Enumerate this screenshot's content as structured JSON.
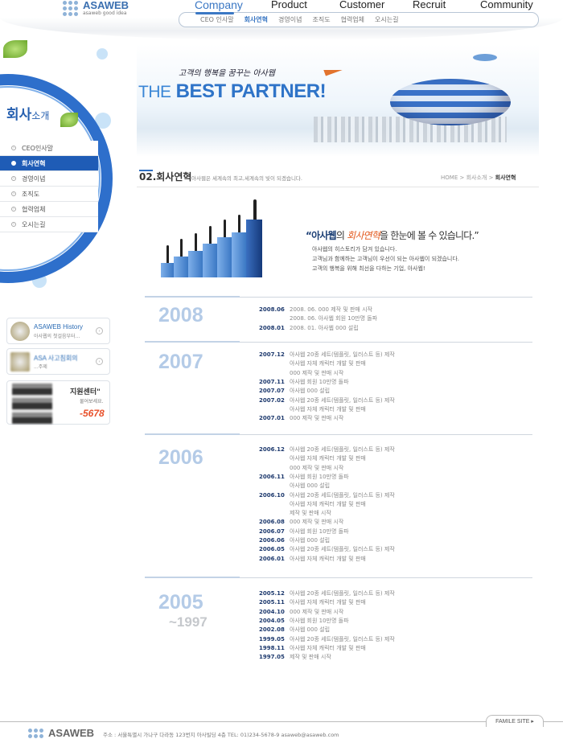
{
  "header": {
    "logo": "ASAWEB",
    "slogan": "asaweb good idea",
    "nav": [
      "Company",
      "Product",
      "Customer",
      "Recruit",
      "Community"
    ],
    "subnav": [
      "CEO 인사말",
      "회사연혁",
      "경영이념",
      "조직도",
      "협력업체",
      "오시는길"
    ],
    "active_subnav": 1
  },
  "sidebar": {
    "title": "회사",
    "title_small": "소개",
    "menu": [
      "CEO인사말",
      "회사연혁",
      "경영이념",
      "조직도",
      "협력업체",
      "오시는길"
    ],
    "active": 1,
    "boxes": [
      {
        "title": "ASAWEB History",
        "sub": "아사웹의 첫걸음부터..."
      },
      {
        "title": "ASA 사고침회의",
        "sub": "...주제"
      },
      {
        "title": "지원센터\"",
        "sub": "물어보세요.",
        "phone": "-5678"
      }
    ]
  },
  "banner": {
    "tagline": "고객의 행복을 꿈꾸는 아사웹",
    "the": "THE",
    "headline": "BEST PARTNER!"
  },
  "section": {
    "num": "02",
    "title": ".회사연혁",
    "subtitle": "아사웹은 세계속의 최고,세계속의 빛이 되겠습니다.",
    "breadcrumb": [
      "HOME",
      "회사소개",
      "회사연혁"
    ]
  },
  "intro": {
    "quote_pre": "“아사웹",
    "quote_mid": "의 ",
    "quote_hl": "회사연혁",
    "quote_post": "을 한눈에 볼 수 있습니다.”",
    "lines": [
      "아사웹의 히스토리가 담겨 있습니다.",
      "고객님과 함께하는 고객님이 우선이 되는 아사웹이 되겠습니다.",
      "고객의 행복을 위해 최선을 다하는 기업, 아사웹!"
    ]
  },
  "timeline": [
    {
      "year": "2008",
      "entries": [
        [
          "2008.06",
          "2008. 06. 000 제작 및 판매 시작"
        ],
        [
          "",
          "2008. 06. 아사웹 회원 10만명 돌파"
        ],
        [
          "2008.01",
          "2008. 01. 아사웹 000 설립"
        ]
      ]
    },
    {
      "year": "2007",
      "entries": [
        [
          "2007.12",
          "아사웹 20종 세트(템플릿, 일러스트 등) 제작"
        ],
        [
          "",
          "아사웹 자체 캐릭터 개발 및 판매"
        ],
        [
          "",
          "000 제작 및 판매 시작"
        ],
        [
          "2007.11",
          "아사웹 회원 10만명 돌파"
        ],
        [
          "2007.07",
          "아사웹 000 설립"
        ],
        [
          "2007.02",
          "아사웹 20종 세트(템플릿, 일러스트 등) 제작"
        ],
        [
          "",
          "아사웹 자체 캐릭터 개발 및 판매"
        ],
        [
          "2007.01",
          "000 제작 및 판매 시작"
        ]
      ]
    },
    {
      "year": "2006",
      "entries": [
        [
          "2006.12",
          "아사웹 20종 세트(템플릿, 일러스트 등) 제작"
        ],
        [
          "",
          "아사웹 자체 캐릭터 개발 및 판매"
        ],
        [
          "",
          "000 제작 및 판매 시작"
        ],
        [
          "2006.11",
          "아사웹 회원 10만명 돌파"
        ],
        [
          "",
          "아사웹 000 설립"
        ],
        [
          "2006.10",
          "아사웹 20종 세트(템플릿, 일러스트 등) 제작"
        ],
        [
          "",
          "아사웹 자체 캐릭터 개발 및 판매"
        ],
        [
          "",
          "제작 및 판매 시작"
        ],
        [
          "2006.08",
          "000 제작 및 판매 시작"
        ],
        [
          "2006.07",
          "아사웹 회원 10만명 돌파"
        ],
        [
          "2006.06",
          "아사웹 000 설립"
        ],
        [
          "2006.05",
          "아사웹 20종 세트(템플릿, 일러스트 등) 제작"
        ],
        [
          "2006.01",
          "아사웹 자체 캐릭터 개발 및 판매"
        ]
      ]
    },
    {
      "year": "2005",
      "year2": "~1997",
      "entries": [
        [
          "2005.12",
          "아사웹 20종 세트(템플릿, 일러스트 등) 제작"
        ],
        [
          "2005.11",
          "아사웹 자체 캐릭터 개발 및 판매"
        ],
        [
          "2004.10",
          "000 제작 및 판매 시작"
        ],
        [
          "2004.05",
          "아사웹 회원 10만명 돌파"
        ],
        [
          "2002.08",
          "아사웹 000 설립"
        ],
        [
          "1999.05",
          "아사웹 20종 세트(템플릿, 일러스트 등) 제작"
        ],
        [
          "1998.11",
          "아사웹 자체 캐릭터 개발 및 판매"
        ],
        [
          "1997.05",
          "제작 및 판매 시작"
        ]
      ]
    }
  ],
  "footer": {
    "logo": "ASAWEB",
    "family_site": "FAMILE SITE ▸",
    "address": "주소 : 서울특별시 가나구 다라동 123번지 아사빌딩 4층 TEL: 01)234-5678-9 asaweb@asaweb.com"
  }
}
